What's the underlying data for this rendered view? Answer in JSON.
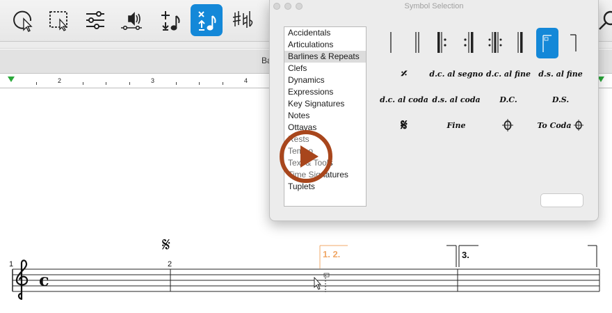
{
  "toolbar": {
    "tools": [
      {
        "name": "selection-tool",
        "icon": "arrow-cursor-icon",
        "active": false
      },
      {
        "name": "marquee-tool",
        "icon": "marquee-select-icon",
        "active": false
      },
      {
        "name": "mixer-tool",
        "icon": "sliders-icon",
        "active": false
      },
      {
        "name": "playback-tool",
        "icon": "speaker-icon",
        "active": false
      },
      {
        "name": "note-entry-tool",
        "icon": "add-note-icon",
        "active": false
      },
      {
        "name": "symbol-tool",
        "icon": "symbol-note-icon",
        "active": true
      },
      {
        "name": "accidentals-tool",
        "icon": "accidentals-icon",
        "active": false
      },
      {
        "name": "search-tool",
        "icon": "magnifier-icon",
        "active": false
      }
    ],
    "accent_color": "#1488d8"
  },
  "tab": {
    "label": "Ba"
  },
  "ruler": {
    "numbers": [
      "2",
      "3",
      "4"
    ]
  },
  "dialog": {
    "title": "Symbol Selection",
    "categories": [
      "Accidentals",
      "Articulations",
      "Barlines & Repeats",
      "Clefs",
      "Dynamics",
      "Expressions",
      "Key Signatures",
      "Notes",
      "Ottavas",
      "Rests",
      "Tempo",
      "Text & Tools",
      "Time Signatures",
      "Tuplets"
    ],
    "selected_category": "Barlines & Repeats",
    "symbols": {
      "row2": [
        "d.c. al segno",
        "d.c. al fine",
        "d.s. al fine"
      ],
      "row3": [
        "d.c. al coda",
        "d.s. al coda",
        "D.C.",
        "D.S."
      ],
      "row4": [
        "Fine",
        "To Coda"
      ]
    },
    "selected_symbol": "first-ending"
  },
  "score": {
    "measure_numbers": [
      "1",
      "2"
    ],
    "ending_first": "1. 2.",
    "ending_second": "3.",
    "ending_preview_color": "#f0a868"
  },
  "overlay": {
    "play_color": "#a8461c"
  }
}
